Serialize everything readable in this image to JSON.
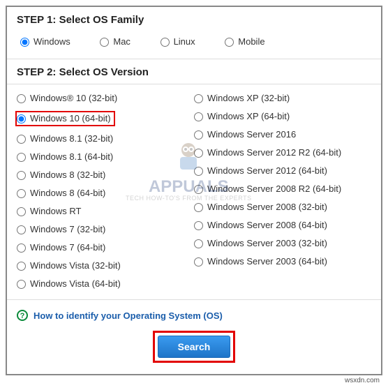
{
  "steps": {
    "step1_title": "STEP 1: Select OS Family",
    "step2_title": "STEP 2: Select OS Version"
  },
  "os_families": [
    {
      "label": "Windows",
      "selected": true
    },
    {
      "label": "Mac",
      "selected": false
    },
    {
      "label": "Linux",
      "selected": false
    },
    {
      "label": "Mobile",
      "selected": false
    }
  ],
  "os_versions_left": [
    {
      "label": "Windows® 10 (32-bit)",
      "selected": false,
      "highlight": false
    },
    {
      "label": "Windows 10 (64-bit)",
      "selected": true,
      "highlight": true
    },
    {
      "label": "Windows 8.1 (32-bit)",
      "selected": false,
      "highlight": false
    },
    {
      "label": "Windows 8.1 (64-bit)",
      "selected": false,
      "highlight": false
    },
    {
      "label": "Windows 8 (32-bit)",
      "selected": false,
      "highlight": false
    },
    {
      "label": "Windows 8 (64-bit)",
      "selected": false,
      "highlight": false
    },
    {
      "label": "Windows RT",
      "selected": false,
      "highlight": false
    },
    {
      "label": "Windows 7 (32-bit)",
      "selected": false,
      "highlight": false
    },
    {
      "label": "Windows 7 (64-bit)",
      "selected": false,
      "highlight": false
    },
    {
      "label": "Windows Vista (32-bit)",
      "selected": false,
      "highlight": false
    },
    {
      "label": "Windows Vista (64-bit)",
      "selected": false,
      "highlight": false
    }
  ],
  "os_versions_right": [
    {
      "label": "Windows XP (32-bit)",
      "selected": false
    },
    {
      "label": "Windows XP (64-bit)",
      "selected": false
    },
    {
      "label": "Windows Server 2016",
      "selected": false
    },
    {
      "label": "Windows Server 2012 R2 (64-bit)",
      "selected": false
    },
    {
      "label": "Windows Server 2012 (64-bit)",
      "selected": false
    },
    {
      "label": "Windows Server 2008 R2 (64-bit)",
      "selected": false
    },
    {
      "label": "Windows Server 2008 (32-bit)",
      "selected": false
    },
    {
      "label": "Windows Server 2008 (64-bit)",
      "selected": false
    },
    {
      "label": "Windows Server 2003 (32-bit)",
      "selected": false
    },
    {
      "label": "Windows Server 2003 (64-bit)",
      "selected": false
    }
  ],
  "help": {
    "text": "How to identify your Operating System (OS)"
  },
  "search_button": "Search",
  "watermark": {
    "brand": "APPUALS",
    "tag": "TECH HOW-TO'S FROM THE EXPERTS"
  },
  "source": "wsxdn.com"
}
